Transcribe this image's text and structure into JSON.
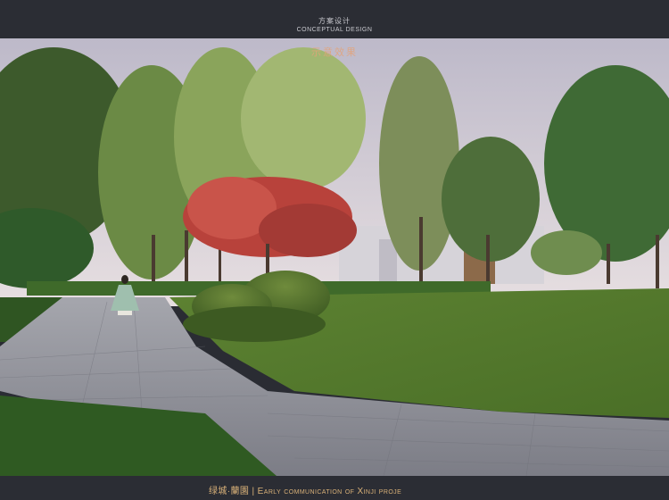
{
  "header": {
    "title_cn": "方案设计",
    "title_en": "CONCEPTUAL DESIGN"
  },
  "overlay": {
    "title": "示意效果"
  },
  "footer": {
    "text": "绿城·蘭園 | Early communication of Xinji proje"
  },
  "colors": {
    "frame": "#2b2d34",
    "sky": "#cfc8d4",
    "lawn": "#557a2c",
    "path": "#8e8f97",
    "accent_text": "#d9b178",
    "maple": "#b8423b"
  }
}
